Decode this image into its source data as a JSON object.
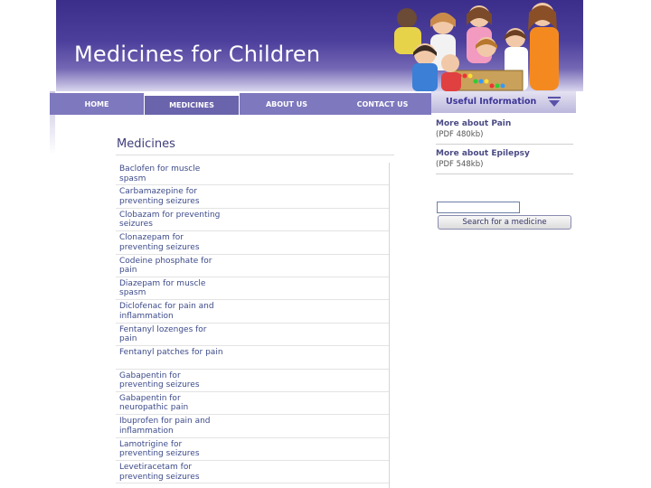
{
  "header": {
    "site_title": "Medicines for Children"
  },
  "nav": {
    "items": [
      {
        "label": "HOME"
      },
      {
        "label": "MEDICINES"
      },
      {
        "label": "ABOUT US"
      },
      {
        "label": "CONTACT US"
      }
    ]
  },
  "sidebar": {
    "title": "Useful Information",
    "items": [
      {
        "title": "More about Pain",
        "sub": "(PDF 480kb)"
      },
      {
        "title": "More about Epilepsy",
        "sub": "(PDF 548kb)"
      }
    ],
    "search_button": "Search for a medicine",
    "search_value": ""
  },
  "main": {
    "title": "Medicines",
    "medicines": [
      "Baclofen for muscle spasm",
      "Carbamazepine for preventing seizures",
      "Clobazam for preventing seizures",
      "Clonazepam for preventing seizures",
      "Codeine phosphate for pain",
      "Diazepam for muscle spasm",
      "Diclofenac for pain and inflammation",
      "Fentanyl lozenges for pain",
      "Fentanyl patches for pain",
      "Gabapentin for preventing seizures",
      "Gabapentin for neuropathic pain",
      "Ibuprofen for pain and inflammation",
      "Lamotrigine for preventing seizures",
      "Levetiracetam for preventing seizures"
    ]
  },
  "colors": {
    "banner": "#4c3f9c",
    "nav": "#7e78be",
    "link": "#3d4b8a"
  }
}
